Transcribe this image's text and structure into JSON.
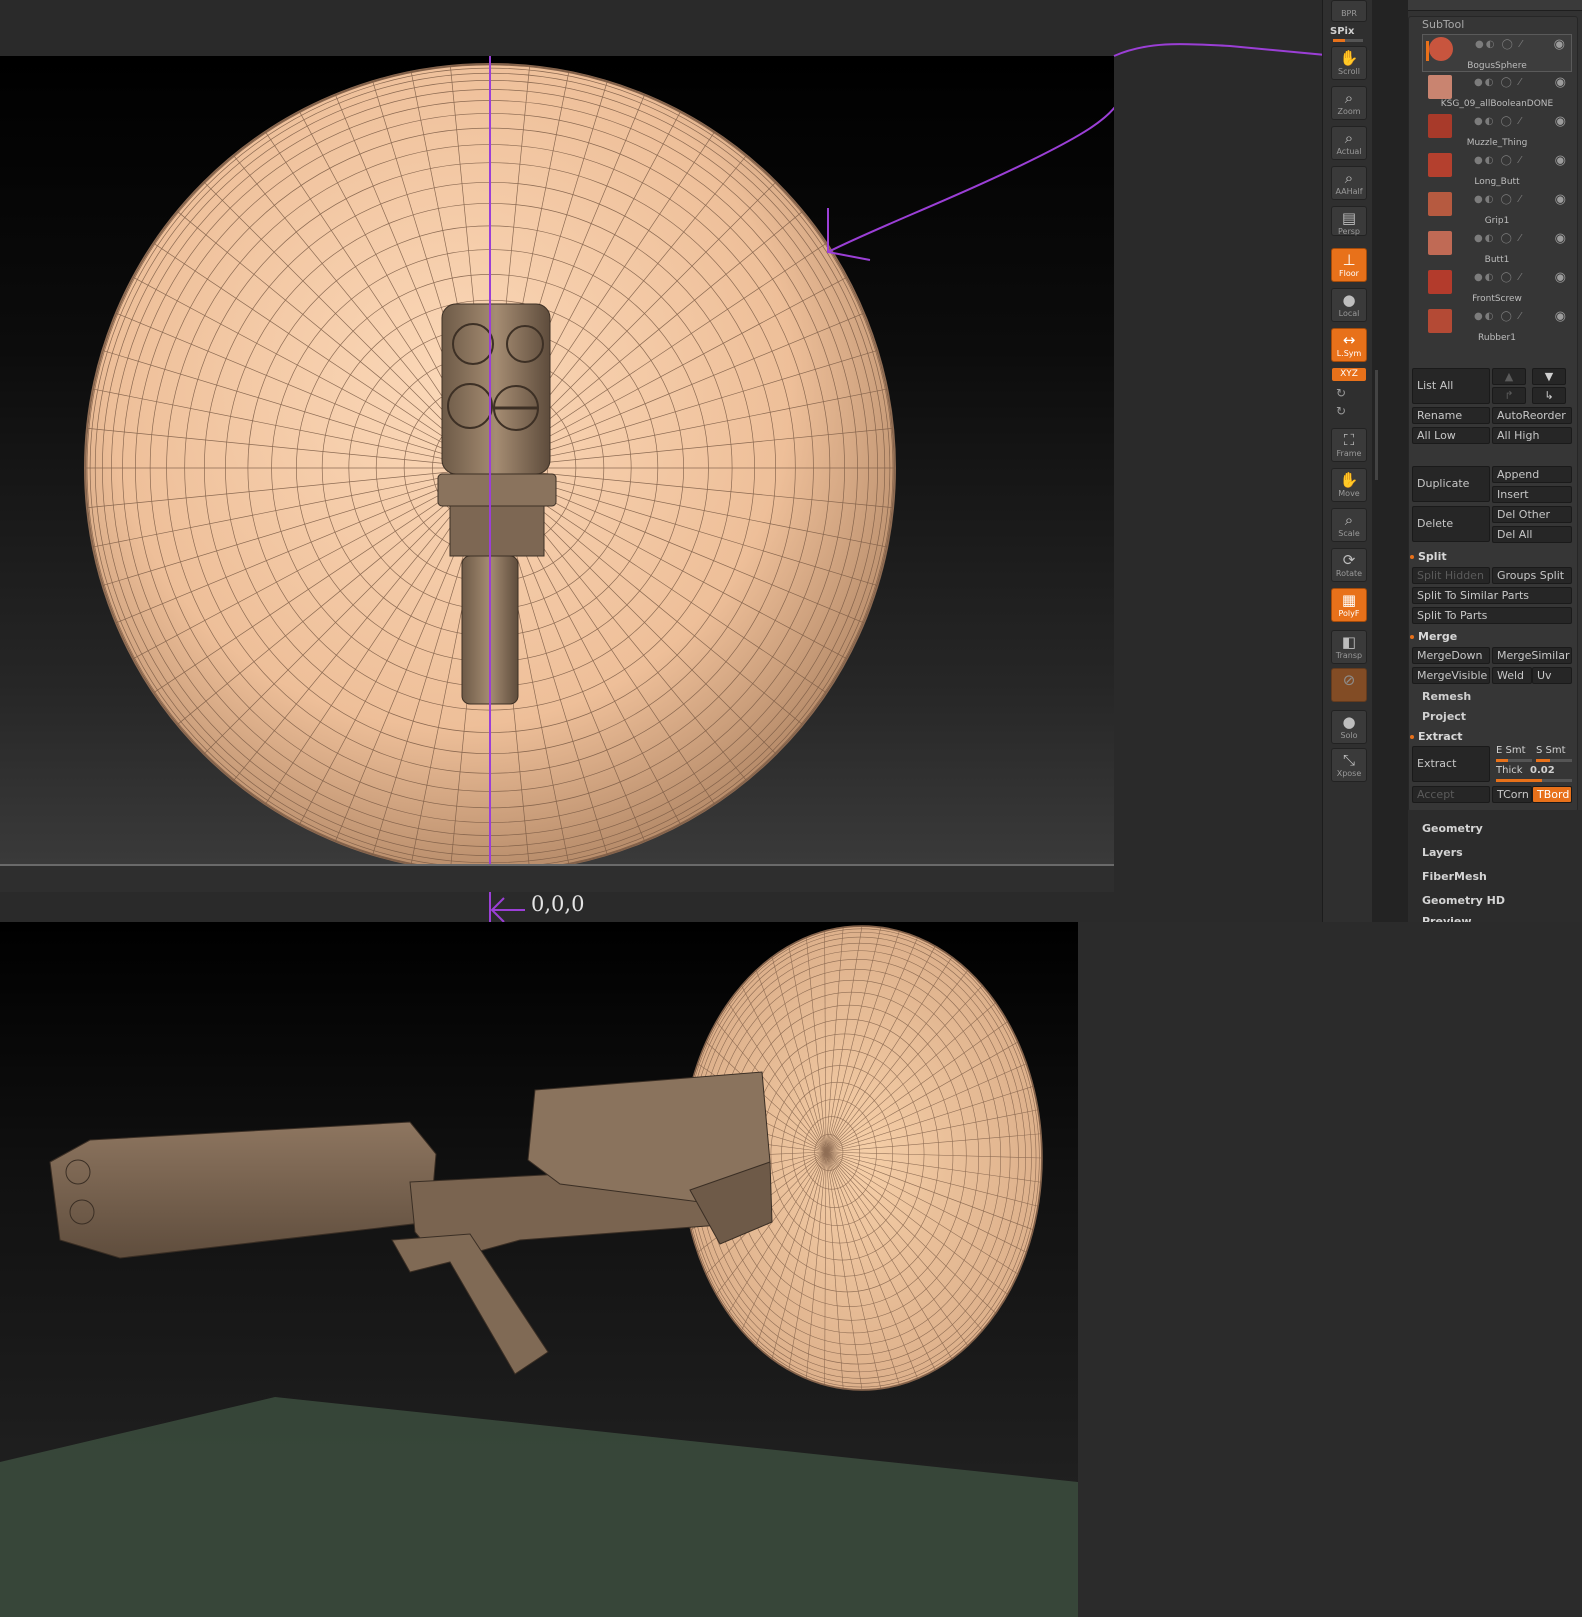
{
  "annotation": {
    "origin_label": "0,0,0"
  },
  "shelf": {
    "bpr": "BPR",
    "spix": "SPix",
    "buttons": [
      {
        "label": "Scroll"
      },
      {
        "label": "Zoom"
      },
      {
        "label": "Actual"
      },
      {
        "label": "AAHalf"
      },
      {
        "label": "Persp"
      },
      {
        "label": "Floor"
      },
      {
        "label": "Local"
      },
      {
        "label": "L.Sym"
      },
      {
        "label": "Frame"
      },
      {
        "label": "Move"
      },
      {
        "label": "Scale"
      },
      {
        "label": "Rotate"
      },
      {
        "label": "PolyF"
      },
      {
        "label": "Transp"
      },
      {
        "label": "Solo"
      },
      {
        "label": "Xpose"
      }
    ],
    "xyz": "XYZ"
  },
  "subtool": {
    "title": "SubTool",
    "items": [
      {
        "name": "BogusSphere",
        "color": "#c8553e"
      },
      {
        "name": "KSG_09_allBooleanDONE",
        "color": "#c98470"
      },
      {
        "name": "Muzzle_Thing",
        "color": "#a83a2a"
      },
      {
        "name": "Long_Butt",
        "color": "#b4402e"
      },
      {
        "name": "Grip1",
        "color": "#b65a40"
      },
      {
        "name": "Butt1",
        "color": "#c06a55"
      },
      {
        "name": "FrontScrew",
        "color": "#b33b2c"
      },
      {
        "name": "Rubber1",
        "color": "#b44a35"
      }
    ],
    "list_all": "List  All",
    "rename": "Rename",
    "autoreorder": "AutoReorder",
    "all_low": "All Low",
    "all_high": "All High",
    "duplicate": "Duplicate",
    "append": "Append",
    "insert": "Insert",
    "delete": "Delete",
    "del_other": "Del Other",
    "del_all": "Del All",
    "split": {
      "title": "Split",
      "split_hidden": "Split Hidden",
      "groups_split": "Groups Split",
      "split_similar": "Split To Similar Parts",
      "split_parts": "Split To Parts"
    },
    "merge": {
      "title": "Merge",
      "merge_down": "MergeDown",
      "merge_similar": "MergeSimilar",
      "merge_visible": "MergeVisible",
      "weld": "Weld",
      "uv": "Uv"
    },
    "remesh": "Remesh",
    "project": "Project",
    "extract": {
      "title": "Extract",
      "button": "Extract",
      "e_smt": "E Smt",
      "s_smt": "S Smt",
      "thick_label": "Thick",
      "thick_value": "0.02",
      "accept": "Accept",
      "tcorn": "TCorn",
      "tbord": "TBord"
    }
  },
  "menus": [
    "Geometry",
    "Layers",
    "FiberMesh",
    "Geometry HD",
    "Preview"
  ],
  "colors": {
    "accent": "#e8711a",
    "annotation": "#9b3fd6",
    "brush_ring": "#b3211d",
    "clay": "#f0c49e"
  }
}
